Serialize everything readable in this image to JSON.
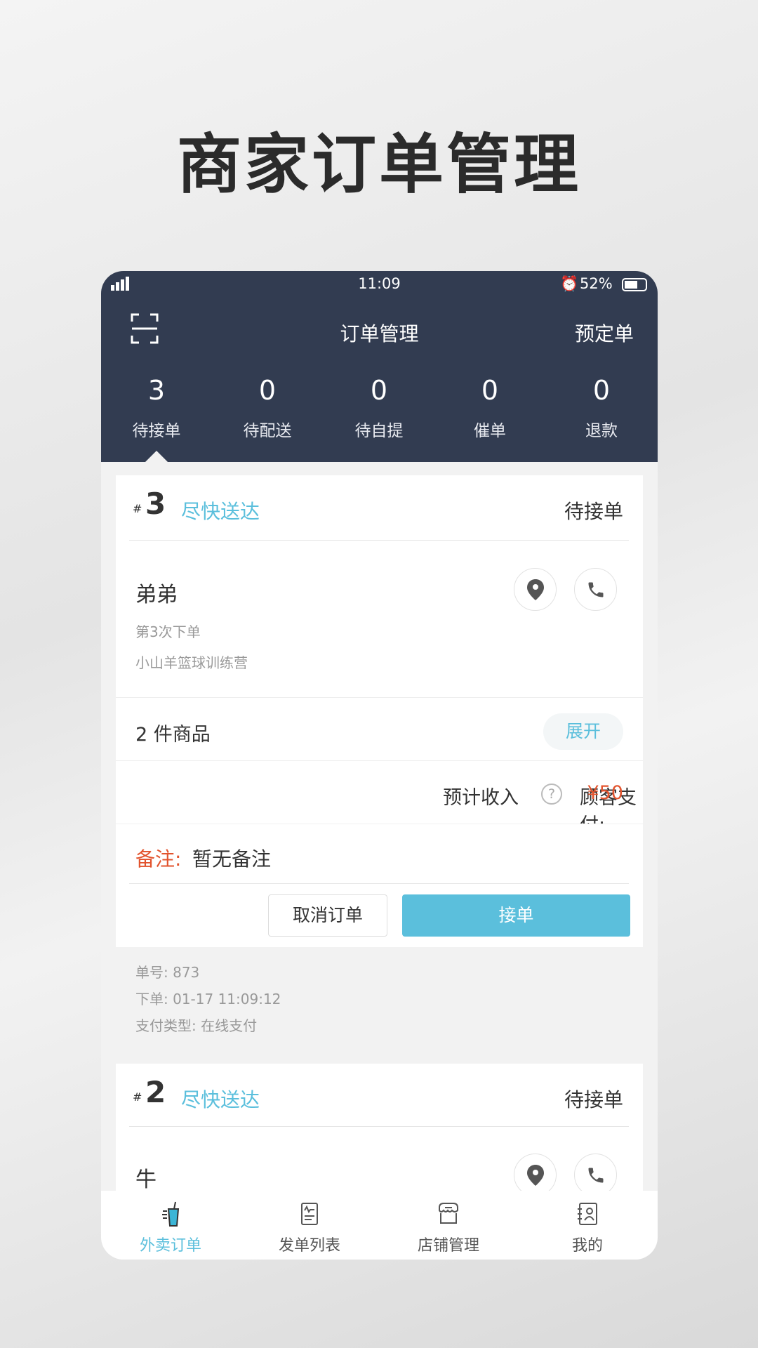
{
  "headline": "商家订单管理",
  "status_bar": {
    "time": "11:09",
    "battery": "52%"
  },
  "header": {
    "title": "订单管理",
    "right_action": "预定单"
  },
  "counters": [
    {
      "count": "3",
      "label": "待接单"
    },
    {
      "count": "0",
      "label": "待配送"
    },
    {
      "count": "0",
      "label": "待自提"
    },
    {
      "count": "0",
      "label": "催单"
    },
    {
      "count": "0",
      "label": "退款"
    }
  ],
  "orders": [
    {
      "hash": "#",
      "number": "3",
      "delivery": "尽快送达",
      "status": "待接单",
      "customer": "弟弟",
      "order_count": "第3次下单",
      "address": "小山羊篮球训练营",
      "items": "2 件商品",
      "expand": "展开",
      "income_label": "预计收入",
      "paid_label": "顾客支付:",
      "paid": "¥50",
      "remark_label": "备注:",
      "remark": "暂无备注",
      "cancel": "取消订单",
      "accept": "接单",
      "order_no": "单号: 873",
      "order_time": "下单: 01-17 11:09:12",
      "pay_type": "支付类型: 在线支付"
    },
    {
      "hash": "#",
      "number": "2",
      "delivery": "尽快送达",
      "status": "待接单",
      "customer": "牛"
    }
  ],
  "tabs": [
    {
      "label": "外卖订单",
      "icon": "takeout-icon",
      "active": true
    },
    {
      "label": "发单列表",
      "icon": "receipt-icon"
    },
    {
      "label": "店铺管理",
      "icon": "store-icon"
    },
    {
      "label": "我的",
      "icon": "profile-icon"
    }
  ],
  "colors": {
    "header": "#323c51",
    "accent": "#5bbfdc",
    "price": "#e2532d"
  }
}
